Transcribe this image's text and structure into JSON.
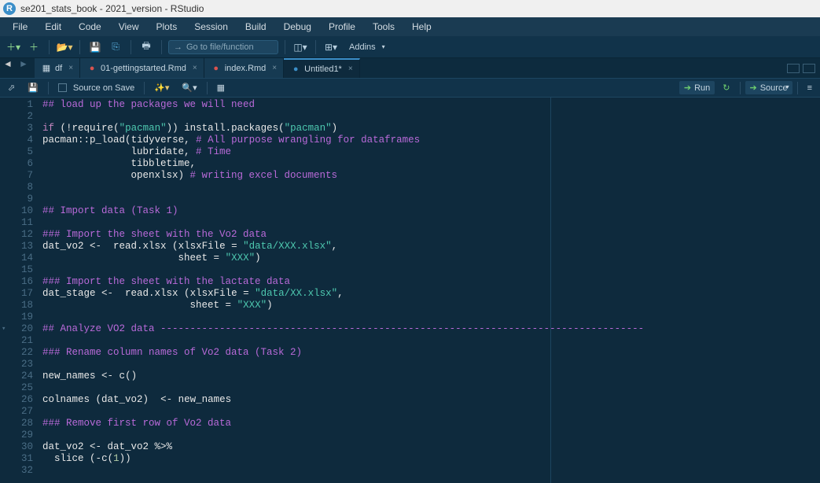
{
  "window_title": "se201_stats_book - 2021_version - RStudio",
  "menus": [
    "File",
    "Edit",
    "Code",
    "View",
    "Plots",
    "Session",
    "Build",
    "Debug",
    "Profile",
    "Tools",
    "Help"
  ],
  "goto_placeholder": "Go to file/function",
  "addins_label": "Addins",
  "tabs": [
    {
      "label": "df",
      "icon": "table",
      "active": false
    },
    {
      "label": "01-gettingstarted.Rmd",
      "icon": "rmd",
      "active": false
    },
    {
      "label": "index.Rmd",
      "icon": "rmd",
      "active": false
    },
    {
      "label": "Untitled1*",
      "icon": "r",
      "active": true
    }
  ],
  "src_toolbar": {
    "source_on_save": "Source on Save",
    "run": "Run",
    "source": "Source"
  },
  "code_lines": [
    [
      [
        "c-comment",
        "## load up the packages we will need"
      ]
    ],
    [],
    [
      [
        "c-keyword",
        "if"
      ],
      [
        "c-paren",
        " ("
      ],
      [
        "c-op",
        "!"
      ],
      [
        "c-func",
        "require"
      ],
      [
        "c-paren",
        "("
      ],
      [
        "c-string",
        "\"pacman\""
      ],
      [
        "c-paren",
        ")) "
      ],
      [
        "c-func",
        "install.packages"
      ],
      [
        "c-paren",
        "("
      ],
      [
        "c-string",
        "\"pacman\""
      ],
      [
        "c-paren",
        ")"
      ]
    ],
    [
      [
        "c-id",
        "pacman"
      ],
      [
        "c-op",
        "::"
      ],
      [
        "c-func",
        "p_load"
      ],
      [
        "c-paren",
        "("
      ],
      [
        "c-id",
        "tidyverse, "
      ],
      [
        "c-comment",
        "# All purpose wrangling for dataframes"
      ]
    ],
    [
      [
        "c-id",
        "               lubridate, "
      ],
      [
        "c-comment",
        "# Time"
      ]
    ],
    [
      [
        "c-id",
        "               tibbletime,"
      ]
    ],
    [
      [
        "c-id",
        "               openxlsx) "
      ],
      [
        "c-comment",
        "# writing excel documents"
      ]
    ],
    [],
    [],
    [
      [
        "c-comment",
        "## Import data (Task 1)"
      ]
    ],
    [],
    [
      [
        "c-comment",
        "### Import the sheet with the Vo2 data"
      ]
    ],
    [
      [
        "c-id",
        "dat_vo2 "
      ],
      [
        "c-op",
        "<-"
      ],
      [
        "c-id",
        "  read.xlsx "
      ],
      [
        "c-paren",
        "("
      ],
      [
        "c-id",
        "xlsxFile "
      ],
      [
        "c-op",
        "="
      ],
      [
        "c-id",
        " "
      ],
      [
        "c-string",
        "\"data/XXX.xlsx\""
      ],
      [
        "c-id",
        ","
      ]
    ],
    [
      [
        "c-id",
        "                       sheet "
      ],
      [
        "c-op",
        "="
      ],
      [
        "c-id",
        " "
      ],
      [
        "c-string",
        "\"XXX\""
      ],
      [
        "c-paren",
        ")"
      ]
    ],
    [],
    [
      [
        "c-comment",
        "### Import the sheet with the lactate data"
      ]
    ],
    [
      [
        "c-id",
        "dat_stage "
      ],
      [
        "c-op",
        "<-"
      ],
      [
        "c-id",
        "  read.xlsx "
      ],
      [
        "c-paren",
        "("
      ],
      [
        "c-id",
        "xlsxFile "
      ],
      [
        "c-op",
        "="
      ],
      [
        "c-id",
        " "
      ],
      [
        "c-string",
        "\"data/XX.xlsx\""
      ],
      [
        "c-id",
        ","
      ]
    ],
    [
      [
        "c-id",
        "                         sheet "
      ],
      [
        "c-op",
        "="
      ],
      [
        "c-id",
        " "
      ],
      [
        "c-string",
        "\"XXX\""
      ],
      [
        "c-paren",
        ")"
      ]
    ],
    [],
    [
      [
        "c-comment",
        "## Analyze VO2 data "
      ],
      [
        "c-dash",
        "----------------------------------------------------------------------------------"
      ]
    ],
    [],
    [
      [
        "c-comment",
        "### Rename column names of Vo2 data (Task 2)"
      ]
    ],
    [],
    [
      [
        "c-id",
        "new_names "
      ],
      [
        "c-op",
        "<-"
      ],
      [
        "c-id",
        " "
      ],
      [
        "c-func",
        "c"
      ],
      [
        "c-paren",
        "()"
      ]
    ],
    [],
    [
      [
        "c-func",
        "colnames "
      ],
      [
        "c-paren",
        "("
      ],
      [
        "c-id",
        "dat_vo2"
      ],
      [
        "c-paren",
        ")"
      ],
      [
        "c-id",
        "  "
      ],
      [
        "c-op",
        "<-"
      ],
      [
        "c-id",
        " new_names"
      ]
    ],
    [],
    [
      [
        "c-comment",
        "### Remove first row of Vo2 data"
      ]
    ],
    [],
    [
      [
        "c-id",
        "dat_vo2 "
      ],
      [
        "c-op",
        "<-"
      ],
      [
        "c-id",
        " dat_vo2 "
      ],
      [
        "c-op",
        "%>%"
      ]
    ],
    [
      [
        "c-id",
        "  "
      ],
      [
        "c-func",
        "slice "
      ],
      [
        "c-paren",
        "("
      ],
      [
        "c-op",
        "-"
      ],
      [
        "c-func",
        "c"
      ],
      [
        "c-paren",
        "("
      ],
      [
        "c-num",
        "1"
      ],
      [
        "c-paren",
        "))"
      ]
    ],
    []
  ],
  "fold_lines": [
    20
  ]
}
